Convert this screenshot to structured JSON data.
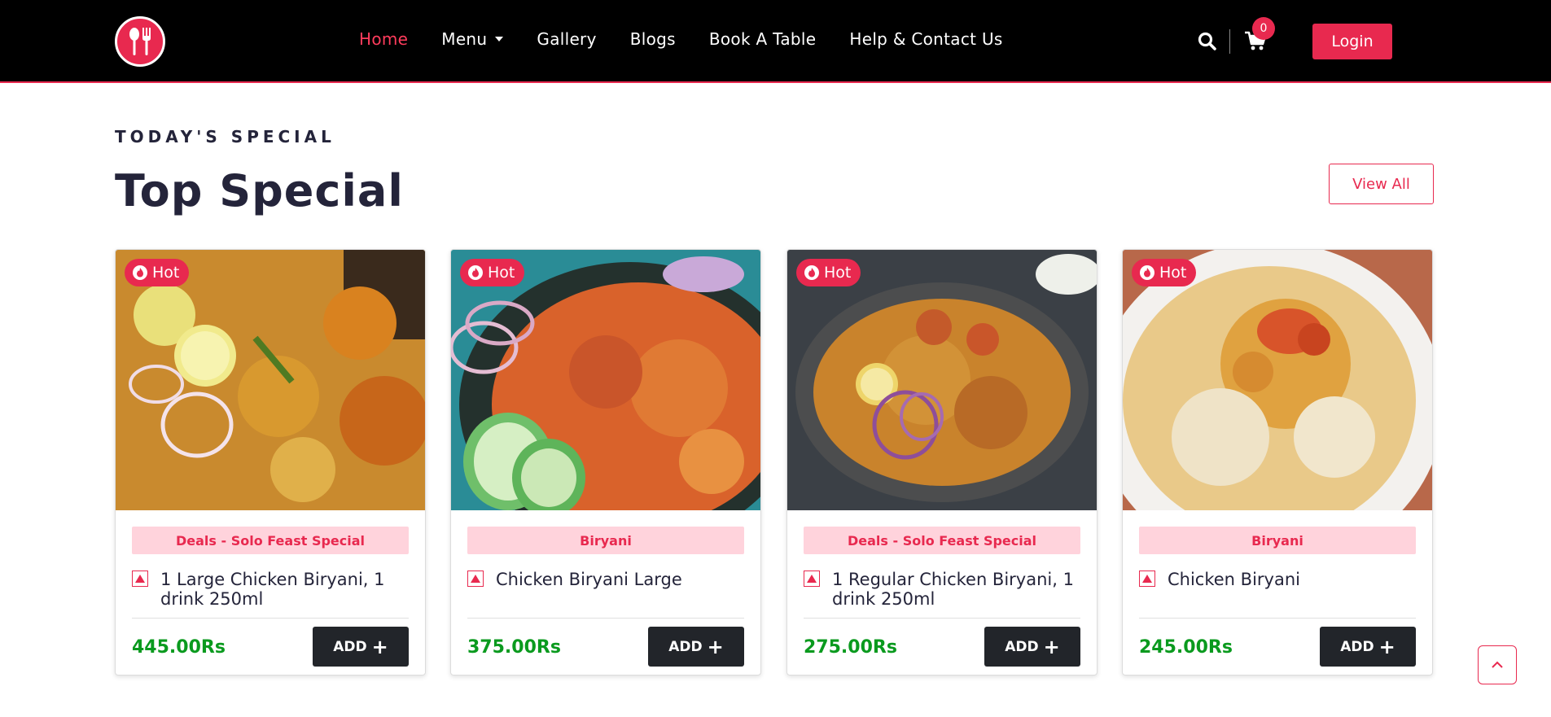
{
  "nav": {
    "logo_icon": "fork-spoon-icon",
    "links": [
      {
        "label": "Home",
        "active": true
      },
      {
        "label": "Menu",
        "active": false,
        "dropdown": true
      },
      {
        "label": "Gallery",
        "active": false
      },
      {
        "label": "Blogs",
        "active": false
      },
      {
        "label": "Book A Table",
        "active": false
      },
      {
        "label": "Help & Contact Us",
        "active": false
      }
    ],
    "cart_count": "0",
    "login_label": "Login"
  },
  "section": {
    "eyebrow": "TODAY'S SPECIAL",
    "title": "Top Special",
    "view_all_label": "View All"
  },
  "cards": [
    {
      "badge": "Hot",
      "category": "Deals - Solo Feast Special",
      "name": "1 Large Chicken Biryani, 1 drink 250ml",
      "price": "445.00Rs",
      "add_label": "ADD"
    },
    {
      "badge": "Hot",
      "category": "Biryani",
      "name": "Chicken Biryani Large",
      "price": "375.00Rs",
      "add_label": "ADD"
    },
    {
      "badge": "Hot",
      "category": "Deals - Solo Feast Special",
      "name": "1 Regular Chicken Biryani, 1 drink 250ml",
      "price": "275.00Rs",
      "add_label": "ADD"
    },
    {
      "badge": "Hot",
      "category": "Biryani",
      "name": "Chicken Biryani",
      "price": "245.00Rs",
      "add_label": "ADD"
    }
  ],
  "colors": {
    "brand": "#e8294f",
    "dark": "#22252a",
    "price": "#0a9a1e",
    "pill_bg": "#ffd3dc"
  }
}
